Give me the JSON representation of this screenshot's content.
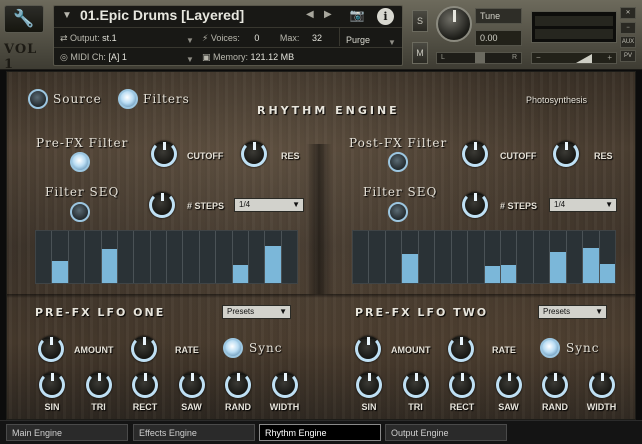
{
  "header": {
    "logo": "VOL 1",
    "instrument_name": "01.Epic Drums [Layered]",
    "output_label": "Output:",
    "output_value": "st.1",
    "voices_label": "Voices:",
    "voices_value": "0",
    "max_label": "Max:",
    "max_value": "32",
    "purge_label": "Purge",
    "midi_label": "MIDI Ch:",
    "midi_value": "[A]  1",
    "memory_label": "Memory:",
    "memory_value": "121.12 MB",
    "s_label": "S",
    "m_label": "M",
    "tune_label": "Tune",
    "tune_value": "0.00",
    "pan_left": "L",
    "pan_right": "R",
    "aux_label": "AUX",
    "pv_label": "PV"
  },
  "engine": {
    "title": "RHYTHM ENGINE",
    "brand": "Photosynthesis",
    "source_label": "Source",
    "filters_label": "Filters",
    "pre_fx_filter_label": "Pre-FX Filter",
    "post_fx_filter_label": "Post-FX Filter",
    "cutoff_label": "CUTOFF",
    "res_label": "RES",
    "filter_seq_label": "Filter SEQ",
    "steps_label": "# STEPS",
    "pre_steps_value": "1/4",
    "post_steps_value": "1/4",
    "pre_seq_values": [
      0,
      0.42,
      0,
      0,
      0.66,
      0,
      0,
      0,
      0,
      0,
      0,
      0,
      0.34,
      0,
      0.72,
      0
    ],
    "post_seq_values": [
      0,
      0,
      0,
      0.55,
      0,
      0,
      0,
      0,
      0.32,
      0.34,
      0,
      0,
      0.6,
      0,
      0.68,
      0.37
    ]
  },
  "lfo": {
    "one_title": "PRE-FX LFO ONE",
    "two_title": "PRE-FX LFO TWO",
    "presets_label": "Presets",
    "amount_label": "AMOUNT",
    "rate_label": "RATE",
    "sync_label": "Sync",
    "shapes": [
      "SIN",
      "TRI",
      "RECT",
      "SAW",
      "RAND",
      "WIDTH"
    ]
  },
  "tabs": [
    "Main Engine",
    "Effects Engine",
    "Rhythm Engine",
    "Output Engine"
  ],
  "active_tab": "Rhythm Engine"
}
